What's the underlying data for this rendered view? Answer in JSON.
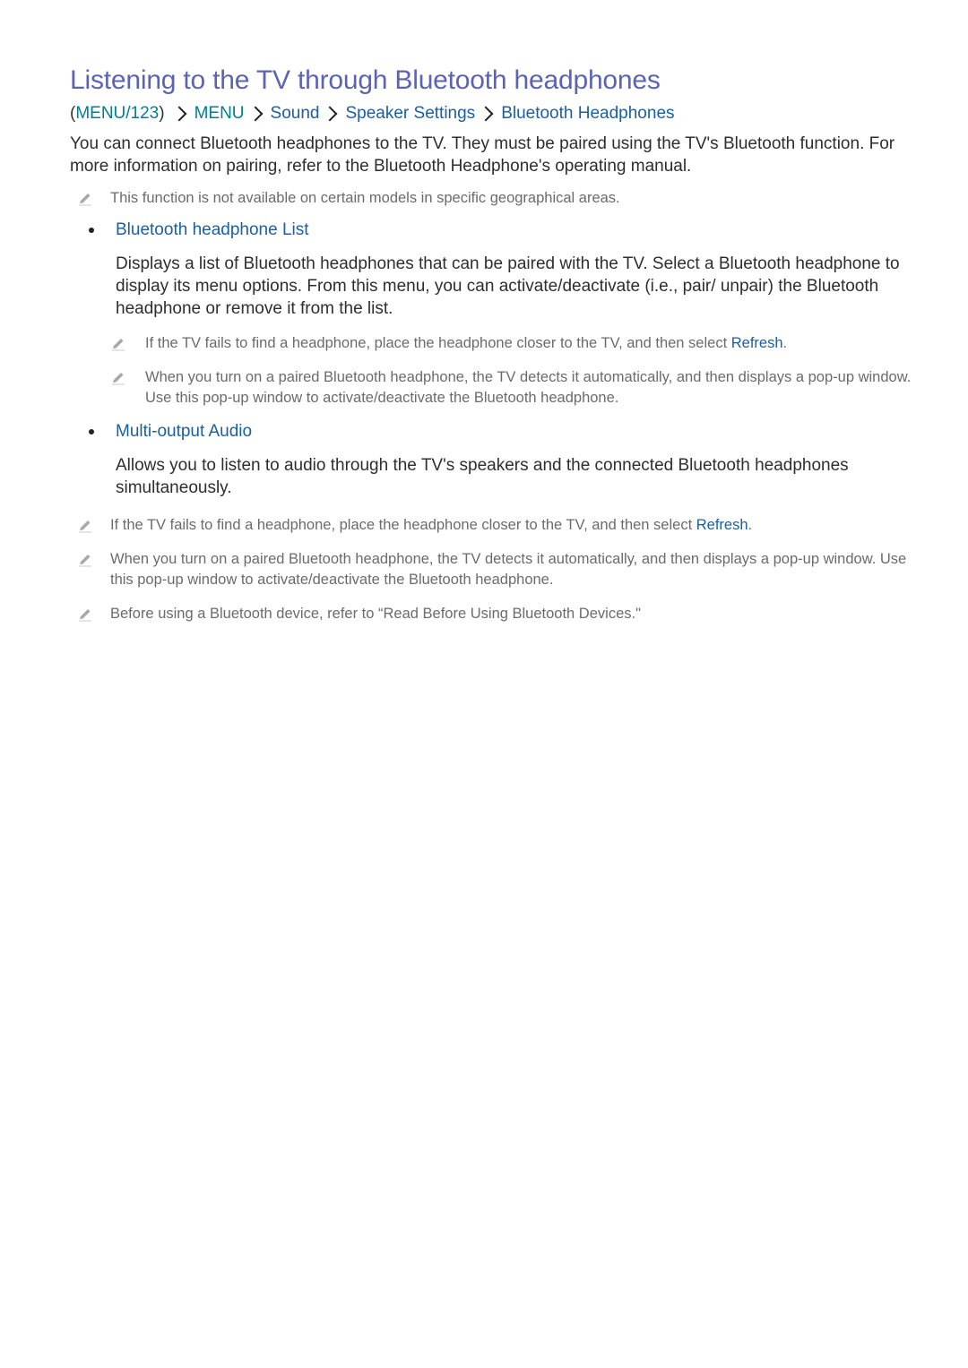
{
  "title": "Listening to the TV through Bluetooth headphones",
  "breadcrumb": {
    "open_paren": "(",
    "remote_key": "MENU/123",
    "close_paren": ")",
    "items": [
      "MENU",
      "Sound",
      "Speaker Settings",
      "Bluetooth Headphones"
    ]
  },
  "intro": "You can connect Bluetooth headphones to the TV. They must be paired using the TV's Bluetooth function. For more information on pairing, refer to the Bluetooth Headphone's operating manual.",
  "availability_note": "This function is not available on certain models in specific geographical areas.",
  "sections": [
    {
      "heading": "Bluetooth headphone List",
      "body": "Displays a list of Bluetooth headphones that can be paired with the TV. Select a Bluetooth headphone to display its menu options. From this menu, you can activate/deactivate (i.e., pair/ unpair) the Bluetooth headphone or remove it from the list.",
      "notes": [
        {
          "text": "If the TV fails to find a headphone, place the headphone closer to the TV, and then select ",
          "ref": "Refresh",
          "tail": "."
        },
        {
          "text": "When you turn on a paired Bluetooth headphone, the TV detects it automatically, and then displays a pop-up window. Use this pop-up window to activate/deactivate the Bluetooth headphone."
        }
      ]
    },
    {
      "heading": "Multi-output Audio",
      "body": "Allows you to listen to audio through the TV's speakers and the connected Bluetooth headphones simultaneously."
    }
  ],
  "footer_notes": [
    {
      "text": "If the TV fails to find a headphone, place the headphone closer to the TV, and then select ",
      "ref": "Refresh",
      "tail": "."
    },
    {
      "text": "When you turn on a paired Bluetooth headphone, the TV detects it automatically, and then displays a pop-up window. Use this pop-up window to activate/deactivate the Bluetooth headphone."
    },
    {
      "text": "Before using a Bluetooth device, refer to “Read Before Using Bluetooth Devices.\""
    }
  ],
  "icons": {
    "note": "pencil-note-icon",
    "separator": "chevron-right-icon"
  },
  "colors": {
    "title": "#5c63b5",
    "link": "#1b5fa0",
    "remote_key": "#00808f",
    "note_text": "#6b6b6b"
  }
}
